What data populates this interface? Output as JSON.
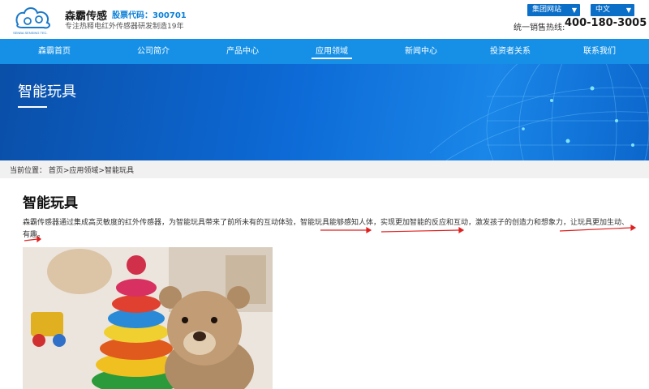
{
  "header": {
    "brand_name": "森霸传感",
    "stock": "股票代码：300701",
    "tagline": "专注热释电红外传感器研发制造19年",
    "logo_text": "SENBA SENSING TEC.",
    "group_select": "集团网站",
    "lang_select": "中文",
    "hotline_label": "统一销售热线:",
    "hotline_number": "400-180-3005"
  },
  "nav": {
    "items": [
      {
        "label": "森霸首页"
      },
      {
        "label": "公司简介"
      },
      {
        "label": "产品中心"
      },
      {
        "label": "应用领域"
      },
      {
        "label": "新闻中心"
      },
      {
        "label": "投资者关系"
      },
      {
        "label": "联系我们"
      }
    ],
    "active_index": 3
  },
  "banner": {
    "title": "智能玩具"
  },
  "breadcrumb": {
    "text": "当前位置：  首页>应用领域>智能玩具"
  },
  "content": {
    "title": "智能玩具",
    "paragraph": "森霸传感器通过集成高灵敏度的红外传感器，为智能玩具带来了前所未有的互动体验，智能玩具能够感知人体，实现更加智能的反应和互动，激发孩子的创造力和想象力，让玩具更加生动、有趣。"
  },
  "colors": {
    "accent": "#1590e6",
    "stock": "#0a7fd6",
    "arrow": "#e02020"
  }
}
